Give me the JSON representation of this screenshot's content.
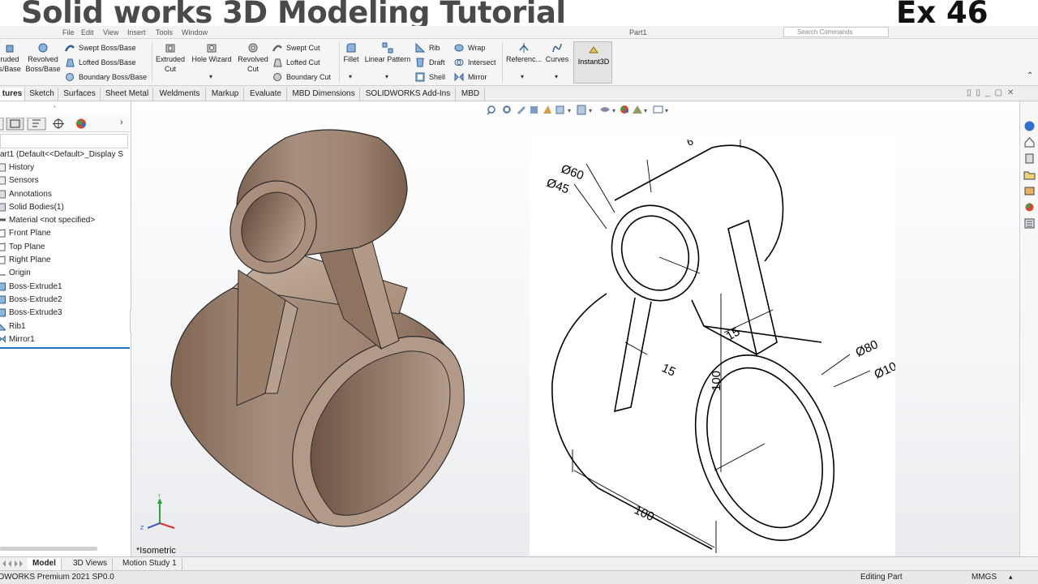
{
  "banner": {
    "title": "Solid works 3D Modeling Tutorial",
    "exercise": "Ex 46"
  },
  "menu": {
    "items": [
      "File",
      "Edit",
      "View",
      "Insert",
      "Tools",
      "Window"
    ],
    "document": "Part1",
    "search_placeholder": "Search Commands"
  },
  "command_manager": {
    "extruded": "ruded s/Base",
    "revolved": "Revolved Boss/Base",
    "swept_boss": "Swept Boss/Base",
    "lofted_boss": "Lofted Boss/Base",
    "boundary_boss": "Boundary Boss/Base",
    "extruded_cut_1": "Extruded",
    "extruded_cut_2": "Cut",
    "hole_wizard": "Hole Wizard",
    "revolved_cut_1": "Revolved",
    "revolved_cut_2": "Cut",
    "swept_cut": "Swept Cut",
    "lofted_cut": "Lofted Cut",
    "boundary_cut": "Boundary Cut",
    "fillet": "Fillet",
    "linear_pattern": "Linear Pattern",
    "rib": "Rib",
    "draft": "Draft",
    "shell": "Shell",
    "wrap": "Wrap",
    "intersect": "Intersect",
    "mirror": "Mirror",
    "reference": "Referenc...",
    "curves": "Curves",
    "instant3d": "Instant3D"
  },
  "tabs": [
    "tures",
    "Sketch",
    "Surfaces",
    "Sheet Metal",
    "Weldments",
    "Markup",
    "Evaluate",
    "MBD Dimensions",
    "SOLIDWORKS Add-Ins",
    "MBD"
  ],
  "feature_tree": [
    "art1  (Default<<Default>_Display S",
    "History",
    "Sensors",
    "Annotations",
    "Solid Bodies(1)",
    "Material <not specified>",
    "Front Plane",
    "Top Plane",
    "Right Plane",
    "Origin",
    "Boss-Extrude1",
    "Boss-Extrude2",
    "Boss-Extrude3",
    "Rib1",
    "Mirror1"
  ],
  "viewport": {
    "view_label": "*Isometric",
    "axis_y": "Y",
    "axis_z": "Z"
  },
  "drawing": {
    "dim_60": "Ø60",
    "dim_45": "Ø45",
    "dim_80": "Ø80",
    "dim_100_dia": "Ø10",
    "dim_15_a": "15",
    "dim_15_b": "15",
    "dim_100_height": "100",
    "dim_100_length": "100",
    "dim_top": "6"
  },
  "bottom_tabs": [
    "Model",
    "3D Views",
    "Motion Study 1"
  ],
  "status": {
    "version": "DWORKS Premium 2021 SP0.0",
    "mode": "Editing Part",
    "units": "MMGS"
  },
  "colors": {
    "model": "#a88d78",
    "accent": "#1f6fbf"
  }
}
